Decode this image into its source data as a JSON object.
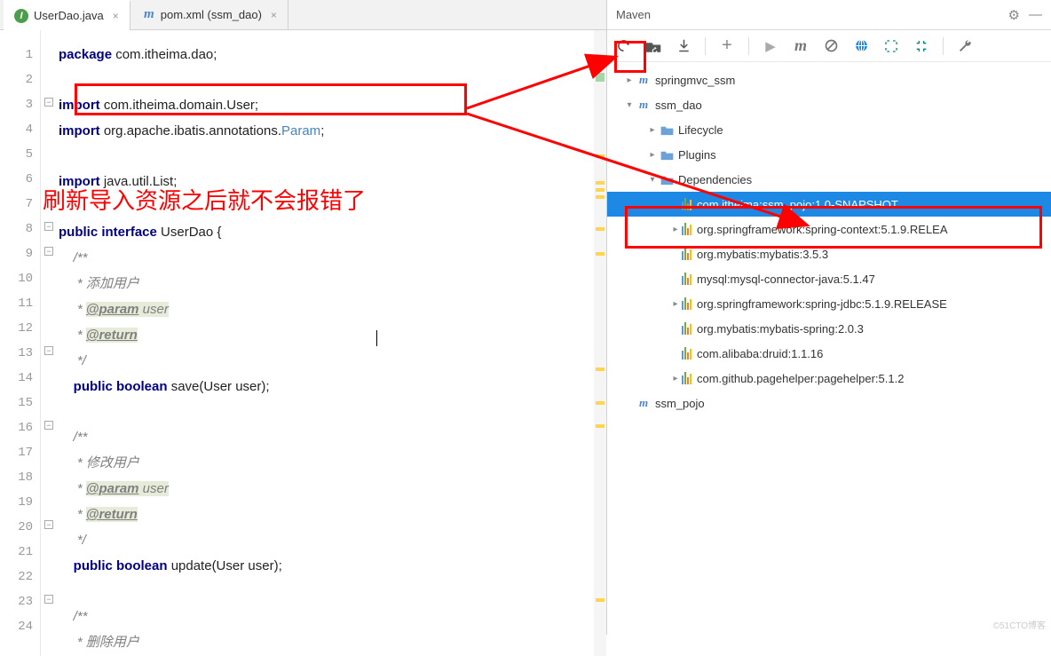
{
  "tabs": [
    {
      "label": "UserDao.java",
      "active": true,
      "icon": "java"
    },
    {
      "label": "pom.xml (ssm_dao)",
      "active": false,
      "icon": "maven"
    }
  ],
  "maven": {
    "title": "Maven",
    "toolbar_icons": [
      "refresh",
      "folders",
      "download",
      "plus",
      "run",
      "m",
      "skip",
      "offline",
      "expand",
      "collapse",
      "wrench"
    ],
    "tree": [
      {
        "depth": 0,
        "arrow": "right",
        "icon": "m",
        "label": "springmvc_ssm"
      },
      {
        "depth": 0,
        "arrow": "down",
        "icon": "m",
        "label": "ssm_dao"
      },
      {
        "depth": 1,
        "arrow": "right",
        "icon": "folder",
        "label": "Lifecycle"
      },
      {
        "depth": 1,
        "arrow": "right",
        "icon": "folder",
        "label": "Plugins"
      },
      {
        "depth": 1,
        "arrow": "down",
        "icon": "folder",
        "label": "Dependencies"
      },
      {
        "depth": 2,
        "arrow": "none",
        "icon": "dep",
        "label": "com.itheima:ssm_pojo:1.0-SNAPSHOT",
        "selected": true
      },
      {
        "depth": 2,
        "arrow": "right",
        "icon": "dep",
        "label": "org.springframework:spring-context:5.1.9.RELEA"
      },
      {
        "depth": 2,
        "arrow": "none",
        "icon": "dep",
        "label": "org.mybatis:mybatis:3.5.3"
      },
      {
        "depth": 2,
        "arrow": "none",
        "icon": "dep",
        "label": "mysql:mysql-connector-java:5.1.47"
      },
      {
        "depth": 2,
        "arrow": "right",
        "icon": "dep",
        "label": "org.springframework:spring-jdbc:5.1.9.RELEASE"
      },
      {
        "depth": 2,
        "arrow": "none",
        "icon": "dep",
        "label": "org.mybatis:mybatis-spring:2.0.3"
      },
      {
        "depth": 2,
        "arrow": "none",
        "icon": "dep",
        "label": "com.alibaba:druid:1.1.16"
      },
      {
        "depth": 2,
        "arrow": "right",
        "icon": "dep",
        "label": "com.github.pagehelper:pagehelper:5.1.2"
      },
      {
        "depth": 0,
        "arrow": "none",
        "icon": "m",
        "label": "ssm_pojo"
      }
    ]
  },
  "annotation_text": "刷新导入资源之后就不会报错了",
  "code_lines": [
    {
      "n": 1,
      "type": "code",
      "tokens": [
        {
          "t": "package ",
          "c": "kw"
        },
        {
          "t": "com.itheima.dao;",
          "c": ""
        }
      ]
    },
    {
      "n": 2,
      "type": "blank"
    },
    {
      "n": 3,
      "type": "code",
      "tokens": [
        {
          "t": "import ",
          "c": "kw"
        },
        {
          "t": "com.itheima.domain.User;",
          "c": ""
        }
      ]
    },
    {
      "n": 4,
      "type": "code",
      "tokens": [
        {
          "t": "import ",
          "c": "kw"
        },
        {
          "t": "org.apache.ibatis.annotations.",
          "c": ""
        },
        {
          "t": "Param",
          "c": "param"
        },
        {
          "t": ";",
          "c": ""
        }
      ]
    },
    {
      "n": 5,
      "type": "blank"
    },
    {
      "n": 6,
      "type": "code",
      "tokens": [
        {
          "t": "import ",
          "c": "kw"
        },
        {
          "t": "java.util.List;",
          "c": ""
        }
      ]
    },
    {
      "n": 7,
      "type": "blank"
    },
    {
      "n": 8,
      "type": "code",
      "tokens": [
        {
          "t": "public interface ",
          "c": "kw"
        },
        {
          "t": "UserDao {",
          "c": ""
        }
      ]
    },
    {
      "n": 9,
      "type": "cm",
      "text": "    /**"
    },
    {
      "n": 10,
      "type": "cm",
      "text": "     * 添加用户"
    },
    {
      "n": 11,
      "type": "cmtag",
      "pre": "     * ",
      "tag": "@param",
      "after": " user"
    },
    {
      "n": 12,
      "type": "cmtag",
      "pre": "     * ",
      "tag": "@return",
      "after": ""
    },
    {
      "n": 13,
      "type": "cm",
      "text": "     */"
    },
    {
      "n": 14,
      "type": "code",
      "tokens": [
        {
          "t": "    ",
          "c": ""
        },
        {
          "t": "public boolean ",
          "c": "kw"
        },
        {
          "t": "save(User user);",
          "c": ""
        }
      ]
    },
    {
      "n": 15,
      "type": "blank"
    },
    {
      "n": 16,
      "type": "cm",
      "text": "    /**"
    },
    {
      "n": 17,
      "type": "cm",
      "text": "     * 修改用户"
    },
    {
      "n": 18,
      "type": "cmtag",
      "pre": "     * ",
      "tag": "@param",
      "after": " user"
    },
    {
      "n": 19,
      "type": "cmtag",
      "pre": "     * ",
      "tag": "@return",
      "after": ""
    },
    {
      "n": 20,
      "type": "cm",
      "text": "     */"
    },
    {
      "n": 21,
      "type": "code",
      "tokens": [
        {
          "t": "    ",
          "c": ""
        },
        {
          "t": "public boolean ",
          "c": "kw"
        },
        {
          "t": "update(User user);",
          "c": ""
        }
      ]
    },
    {
      "n": 22,
      "type": "blank"
    },
    {
      "n": 23,
      "type": "cm",
      "text": "    /**"
    },
    {
      "n": 24,
      "type": "cm",
      "text": "     * 删除用户"
    }
  ],
  "watermark": "©51CTO博客"
}
